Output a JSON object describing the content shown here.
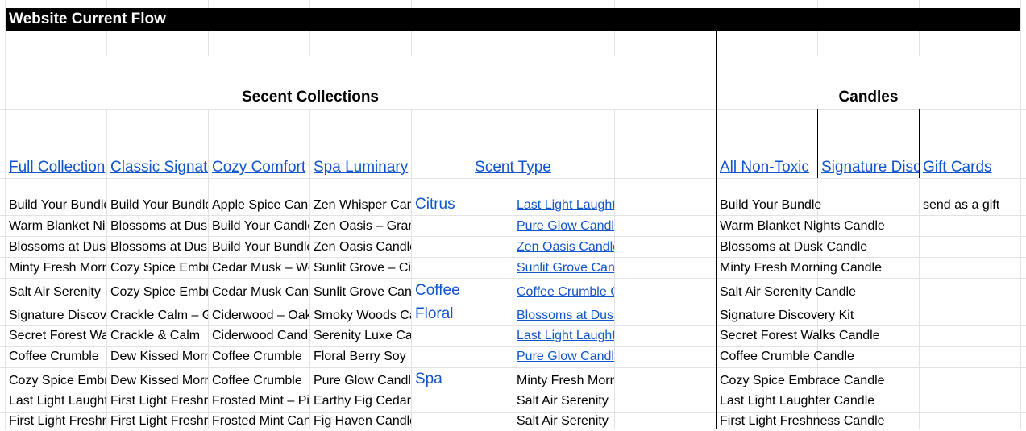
{
  "sheet": {
    "title": "Website Current Flow",
    "sections": {
      "scent_collections": "Secent Collections",
      "candles": "Candles"
    },
    "headers": {
      "full": "Full Collection",
      "classic": "Classic Signature",
      "cozy": "Cozy Comfort",
      "spa": "Spa Luminary",
      "scent_type": "Scent Type",
      "all_non_toxic": "All Non-Toxic",
      "signature_dis": "Signature Discovery",
      "gift_cards": "Gift Cards"
    },
    "scent_types": {
      "citrus": "Citrus",
      "coffee": "Coffee",
      "floral": "Floral",
      "spa": "Spa"
    },
    "colors": {
      "link": "#1155cc",
      "title_bar": "#000000",
      "grid": "#e2e2e2"
    },
    "rows": [
      {
        "a": "Build Your Bundle",
        "b": "Build Your Bundle",
        "c": "Apple Spice Candle",
        "d": "Zen Whisper Candle",
        "f": "Last Light Laughter",
        "h": "Build Your Bundle",
        "j": "send as a gift"
      },
      {
        "a": "Warm Blanket Nights",
        "b": "Blossoms at Dusk",
        "c": "Build Your Candle",
        "d": "Zen Oasis – Grand",
        "f": "Pure Glow Candle",
        "h": "Warm Blanket Nights Candle",
        "j": ""
      },
      {
        "a": "Blossoms at Dusk",
        "b": "Blossoms at Dusk",
        "c": "Build Your Bundle",
        "d": "Zen Oasis Candle",
        "f": "Zen Oasis Candle",
        "h": "Blossoms at Dusk Candle",
        "j": ""
      },
      {
        "a": "Minty Fresh Morning",
        "b": "Cozy Spice Embrace",
        "c": "Cedar Musk – Wood",
        "d": "Sunlit Grove – Citrus",
        "f": "Sunlit Grove Candle",
        "h": "Minty Fresh Morning Candle",
        "j": ""
      },
      {
        "a": "Salt Air Serenity",
        "b": "Cozy Spice Embrace",
        "c": "Cedar Musk Candle",
        "d": "Sunlit Grove Candle",
        "f": "Coffee Crumble Candle",
        "h": "Salt Air Serenity Candle",
        "j": ""
      },
      {
        "a": "Signature Discovery",
        "b": "Crackle Calm – Grand",
        "c": "Ciderwood – Oak",
        "d": "Smoky Woods Candle",
        "f": "Blossoms at Dusk",
        "h": "Signature Discovery Kit",
        "j": ""
      },
      {
        "a": "Secret Forest Walks",
        "b": "Crackle & Calm",
        "c": "Ciderwood Candle",
        "d": "Serenity Luxe Candle",
        "f": "Last Light Laughter",
        "h": "Secret Forest Walks Candle",
        "j": ""
      },
      {
        "a": "Coffee Crumble",
        "b": "Dew Kissed Morning",
        "c": "Coffee Crumble",
        "d": "Floral Berry Soy",
        "f": "Pure Glow Candle",
        "h": "Coffee Crumble Candle",
        "j": ""
      },
      {
        "a": "Cozy Spice Embrace",
        "b": "Dew Kissed Morning",
        "c": "Coffee Crumble",
        "d": "Pure Glow Candle",
        "f": "Minty Fresh Morning",
        "h": "Cozy Spice Embrace Candle",
        "j": ""
      },
      {
        "a": "Last Light Laughter",
        "b": "First Light Freshness",
        "c": "Frosted Mint – Pine",
        "d": "Earthy Fig Cedar",
        "f": "Salt Air Serenity",
        "h": "Last Light Laughter Candle",
        "j": ""
      },
      {
        "a": "First Light Freshness",
        "b": "First Light Freshness",
        "c": "Frosted Mint Candle",
        "d": "Fig Haven Candle",
        "f": "Salt Air Serenity",
        "h": "First Light Freshness Candle",
        "j": ""
      }
    ]
  }
}
